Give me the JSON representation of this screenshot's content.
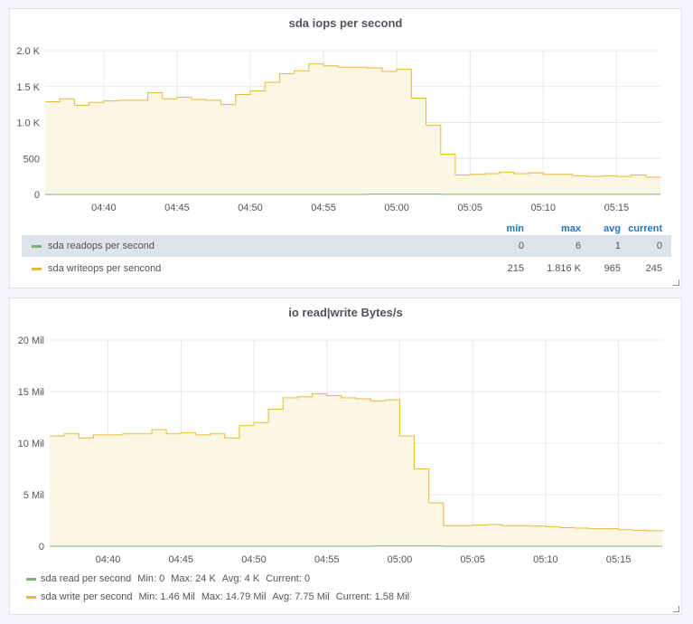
{
  "colors": {
    "read": "#7eb26d",
    "write": "#eab839",
    "write_fill": "#fcf6e5",
    "grid": "#e8e8e8",
    "text": "#52545c",
    "header": "#1f78c1"
  },
  "panel1": {
    "title": "sda iops per second",
    "legend_headers": {
      "min": "min",
      "max": "max",
      "avg": "avg",
      "current": "current"
    },
    "legend_rows": [
      {
        "name": "sda readops per second",
        "min": "0",
        "max": "6",
        "avg": "1",
        "current": "0"
      },
      {
        "name": "sda writeops per sencond",
        "min": "215",
        "max": "1.816 K",
        "avg": "965",
        "current": "245"
      }
    ]
  },
  "panel2": {
    "title": "io read|write Bytes/s",
    "legend": [
      {
        "name": "sda read per second",
        "min": "Min: 0",
        "max": "Max: 24 K",
        "avg": "Avg: 4 K",
        "current": "Current: 0"
      },
      {
        "name": "sda write per second",
        "min": "Min: 1.46 Mil",
        "max": "Max: 14.79 Mil",
        "avg": "Avg: 7.75 Mil",
        "current": "Current: 1.58 Mil"
      }
    ]
  },
  "chart_data": [
    {
      "type": "area",
      "title": "sda iops per second",
      "x_tick_labels": [
        "04:40",
        "04:45",
        "04:50",
        "04:55",
        "05:00",
        "05:05",
        "05:10",
        "05:15"
      ],
      "y_tick_labels": [
        "0",
        "500",
        "1.0 K",
        "1.5 K",
        "2.0 K"
      ],
      "ylim": [
        0,
        2000
      ],
      "x_range_minutes": [
        -24,
        18
      ],
      "grid": true,
      "series": [
        {
          "name": "sda readops per second",
          "color": "#7eb26d",
          "x": [
            -24,
            -10,
            -2,
            3,
            9,
            18
          ],
          "y": [
            0,
            0,
            4,
            2,
            1,
            0
          ]
        },
        {
          "name": "sda writeops per sencond",
          "color": "#eab839",
          "x": [
            -24,
            -23,
            -22,
            -21,
            -20,
            -19,
            -18,
            -17,
            -16,
            -15,
            -14,
            -13,
            -12,
            -11,
            -10,
            -9,
            -8,
            -7,
            -6,
            -5,
            -4,
            -3,
            -2,
            -1,
            0,
            1,
            2,
            3,
            4,
            5,
            6,
            7,
            8,
            9,
            10,
            11,
            12,
            13,
            14,
            15,
            16,
            17,
            18
          ],
          "y": [
            1290,
            1330,
            1240,
            1280,
            1300,
            1310,
            1310,
            1415,
            1330,
            1350,
            1320,
            1310,
            1250,
            1390,
            1440,
            1560,
            1680,
            1720,
            1816,
            1790,
            1770,
            1770,
            1760,
            1710,
            1740,
            1340,
            960,
            560,
            270,
            280,
            290,
            310,
            290,
            300,
            280,
            280,
            260,
            250,
            260,
            250,
            270,
            240,
            245
          ]
        }
      ]
    },
    {
      "type": "area",
      "title": "io read|write Bytes/s",
      "x_tick_labels": [
        "04:40",
        "04:45",
        "04:50",
        "04:55",
        "05:00",
        "05:05",
        "05:10",
        "05:15"
      ],
      "y_tick_labels": [
        "0",
        "5 Mil",
        "10 Mil",
        "15 Mil",
        "20 Mil"
      ],
      "ylim": [
        0,
        20000000
      ],
      "x_range_minutes": [
        -24,
        18
      ],
      "grid": true,
      "series": [
        {
          "name": "sda read per second",
          "color": "#7eb26d",
          "x": [
            -24,
            -10,
            -2,
            3,
            18
          ],
          "y": [
            0,
            0,
            24000,
            0,
            0
          ]
        },
        {
          "name": "sda write per second",
          "color": "#eab839",
          "x": [
            -24,
            -23,
            -22,
            -21,
            -20,
            -19,
            -18,
            -17,
            -16,
            -15,
            -14,
            -13,
            -12,
            -11,
            -10,
            -9,
            -8,
            -7,
            -6,
            -5,
            -4,
            -3,
            -2,
            -1,
            0,
            1,
            2,
            3,
            4,
            5,
            6,
            7,
            8,
            9,
            10,
            11,
            12,
            13,
            14,
            15,
            16,
            17,
            18
          ],
          "y": [
            10700000,
            10900000,
            10500000,
            10800000,
            10800000,
            10900000,
            10900000,
            11300000,
            10900000,
            11000000,
            10800000,
            10900000,
            10500000,
            11700000,
            12000000,
            13300000,
            14400000,
            14500000,
            14790000,
            14600000,
            14400000,
            14300000,
            14100000,
            14200000,
            10700000,
            7500000,
            4200000,
            2000000,
            2000000,
            2050000,
            2100000,
            2000000,
            2000000,
            1950000,
            1900000,
            1800000,
            1750000,
            1700000,
            1700000,
            1600000,
            1550000,
            1500000,
            1580000
          ]
        }
      ]
    }
  ]
}
